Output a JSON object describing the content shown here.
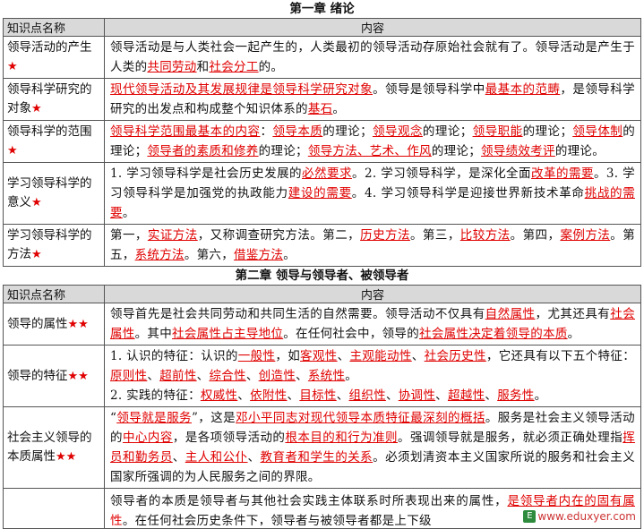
{
  "chapter1": {
    "title": "第一章  绪论",
    "header": {
      "name_col": "知识点名称",
      "content_col": "内容"
    },
    "rows": [
      {
        "name": "领导活动的产生",
        "stars": "★",
        "segments": [
          {
            "t": "领导活动是与人类社会一起产生的，人类最初的领导活动存原始社会就有了。领导活动是产生于人类的"
          },
          {
            "t": "共同劳动",
            "h": true
          },
          {
            "t": "和"
          },
          {
            "t": "社会分工",
            "h": true
          },
          {
            "t": "的。"
          }
        ]
      },
      {
        "name": "领导科学研究的对象",
        "stars": "★",
        "segments": [
          {
            "t": "现代领导活动及其发展规律是领导科学研究对象",
            "h": true
          },
          {
            "t": "。领导是领导科学中"
          },
          {
            "t": "最基本的范畴",
            "h": true
          },
          {
            "t": "，是领导科学研究的出发点和构成整个知识体系的"
          },
          {
            "t": "基石",
            "h": true
          },
          {
            "t": "。"
          }
        ]
      },
      {
        "name": "领导科学的范围",
        "stars": "★",
        "segments": [
          {
            "t": "领导科学范围最基本的内容",
            "h": true
          },
          {
            "t": "："
          },
          {
            "t": "领导本质",
            "h": true
          },
          {
            "t": "的理论；"
          },
          {
            "t": "领导观念",
            "h": true
          },
          {
            "t": "的理论；"
          },
          {
            "t": "领导职能",
            "h": true
          },
          {
            "t": "的理论；"
          },
          {
            "t": "领导体制",
            "h": true
          },
          {
            "t": "的理论；"
          },
          {
            "t": "领导者的素质和修养",
            "h": true
          },
          {
            "t": "的理论；"
          },
          {
            "t": "领导方法、艺术、作风",
            "h": true
          },
          {
            "t": "的理论；"
          },
          {
            "t": "领导绩效考评",
            "h": true
          },
          {
            "t": "的理论。"
          }
        ]
      },
      {
        "name": "学习领导科学的意义",
        "stars": "★",
        "segments": [
          {
            "t": "1. 学习领导科学是社会历史发展的"
          },
          {
            "t": "必然要求",
            "h": true
          },
          {
            "t": "。2. 学习领导科学，是深化全面"
          },
          {
            "t": "改革的需要",
            "h": true
          },
          {
            "t": "。3. 学习领导科学是加强党的执政能力"
          },
          {
            "t": "建设的需要",
            "h": true
          },
          {
            "t": "。4. 学习领导科学是迎接世界新技术革命"
          },
          {
            "t": "挑战的需要",
            "h": true
          },
          {
            "t": "。"
          }
        ]
      },
      {
        "name": "学习领导科学的方法",
        "stars": "★",
        "segments": [
          {
            "t": "第一，"
          },
          {
            "t": "实证方法",
            "h": true
          },
          {
            "t": "，又称调查研究方法。第二，"
          },
          {
            "t": "历史方法",
            "h": true
          },
          {
            "t": "。第三，"
          },
          {
            "t": "比较方法",
            "h": true
          },
          {
            "t": "。第四，"
          },
          {
            "t": "案例方法",
            "h": true
          },
          {
            "t": "。第五，"
          },
          {
            "t": "系统方法",
            "h": true
          },
          {
            "t": "。第六，"
          },
          {
            "t": "借鉴方法",
            "h": true
          },
          {
            "t": "。"
          }
        ]
      }
    ]
  },
  "chapter2": {
    "title": "第二章  领导与领导者、被领导者",
    "header": {
      "name_col": "知识点名称",
      "content_col": "内容"
    },
    "rows": [
      {
        "name": "领导的属性",
        "stars": "★★",
        "segments": [
          {
            "t": "领导首先是社会共同劳动和共同生活的自然需要。领导活动不仅具有"
          },
          {
            "t": "自然属性",
            "h": true
          },
          {
            "t": "，尤其还具有"
          },
          {
            "t": "社会属性",
            "h": true
          },
          {
            "t": "。其中"
          },
          {
            "t": "社会属性占主导地位",
            "h": true
          },
          {
            "t": "。在任何社会中，领导的"
          },
          {
            "t": "社会属性决定着领导的本质",
            "h": true
          },
          {
            "t": "。"
          }
        ]
      },
      {
        "name": "领导的特征",
        "stars": "★★",
        "segments": [
          {
            "t": "1. 认识的特征：认识的"
          },
          {
            "t": "一般性",
            "h": true
          },
          {
            "t": "，如"
          },
          {
            "t": "客观性",
            "h": true
          },
          {
            "t": "、"
          },
          {
            "t": "主观能动性",
            "h": true
          },
          {
            "t": "、"
          },
          {
            "t": "社会历史性",
            "h": true
          },
          {
            "t": "，它还具有以下五个特征："
          },
          {
            "t": "原则性",
            "h": true
          },
          {
            "t": "、"
          },
          {
            "t": "超前性",
            "h": true
          },
          {
            "t": "、"
          },
          {
            "t": "综合性",
            "h": true
          },
          {
            "t": "、"
          },
          {
            "t": "创造性",
            "h": true
          },
          {
            "t": "、"
          },
          {
            "t": "系统性",
            "h": true
          },
          {
            "t": "。"
          },
          {
            "br": true
          },
          {
            "t": "2. 实践的特征："
          },
          {
            "t": "权威性",
            "h": true
          },
          {
            "t": "、"
          },
          {
            "t": "依附性",
            "h": true
          },
          {
            "t": "、"
          },
          {
            "t": "目标性",
            "h": true
          },
          {
            "t": "、"
          },
          {
            "t": "组织性",
            "h": true
          },
          {
            "t": "、"
          },
          {
            "t": "协调性",
            "h": true
          },
          {
            "t": "、"
          },
          {
            "t": "超越性",
            "h": true
          },
          {
            "t": "、"
          },
          {
            "t": "服务性",
            "h": true
          },
          {
            "t": "。"
          }
        ]
      },
      {
        "name": "社会主义领导的本质属性",
        "stars": "★★",
        "segments": [
          {
            "t": "“"
          },
          {
            "t": "领导就是服务",
            "h": true
          },
          {
            "t": "”，这是"
          },
          {
            "t": "邓小平同志对现代领导本质特征最深刻的概括",
            "h": true
          },
          {
            "t": "。服务是社会主义领导活动的"
          },
          {
            "t": "中心内容",
            "h": true
          },
          {
            "t": "，是各项领导活动的"
          },
          {
            "t": "根本目的和行为准则",
            "h": true
          },
          {
            "t": "。强调领导就是服务，就必须正确处理指"
          },
          {
            "t": "挥员和勤务员",
            "h": true
          },
          {
            "t": "、"
          },
          {
            "t": "主人和公仆",
            "h": true
          },
          {
            "t": "、"
          },
          {
            "t": "教育者和学生的关系",
            "h": true
          },
          {
            "t": "。必须划清资本主义国家所说的服务和社会主义国家所强调的为人民服务之间的界限。"
          }
        ]
      },
      {
        "name": "",
        "stars": "",
        "cut": true,
        "segments": [
          {
            "t": "领导者的本质是领导者与其他社会实践主体联系时所表现出来的属性，"
          },
          {
            "t": "是领导者内在的固有属性",
            "h": true
          },
          {
            "t": "。在任何社会历史条件下，领导者与被领导者都是上下级"
          }
        ]
      }
    ]
  },
  "watermark": {
    "logo": "E",
    "text": "www.eduxyer.com"
  }
}
